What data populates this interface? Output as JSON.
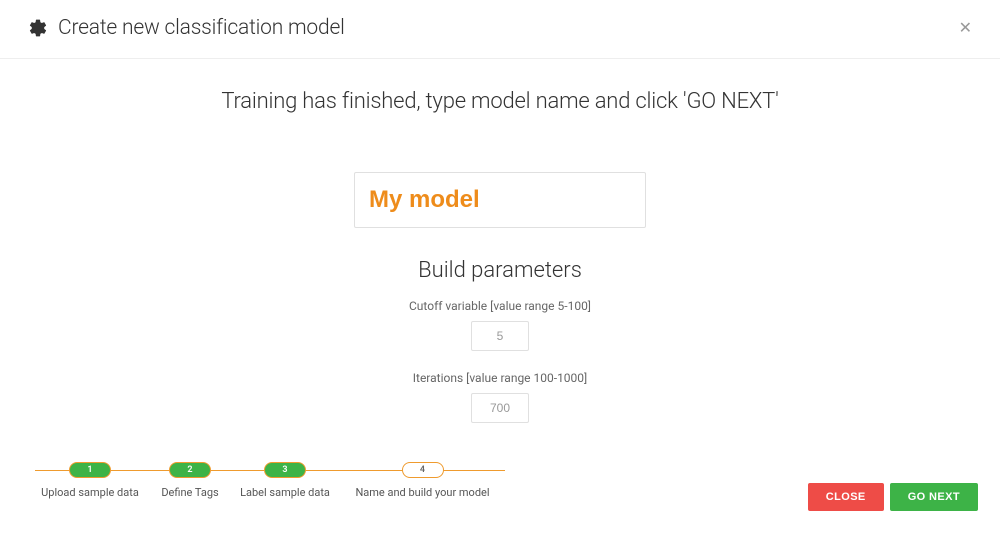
{
  "header": {
    "title": "Create new classification model"
  },
  "main": {
    "instruction": "Training has finished, type model name and click 'GO NEXT'",
    "model_name_value": "My model",
    "build_heading": "Build parameters",
    "cutoff": {
      "label": "Cutoff variable [value range 5-100]",
      "value": "5"
    },
    "iterations": {
      "label": "Iterations [value range 100-1000]",
      "value": "700"
    }
  },
  "stepper": {
    "steps": [
      {
        "num": "1",
        "label": "Upload sample data",
        "state": "done"
      },
      {
        "num": "2",
        "label": "Define Tags",
        "state": "done"
      },
      {
        "num": "3",
        "label": "Label sample data",
        "state": "done"
      },
      {
        "num": "4",
        "label": "Name and build your model",
        "state": "active"
      }
    ]
  },
  "footer": {
    "close_label": "CLOSE",
    "next_label": "GO NEXT"
  }
}
